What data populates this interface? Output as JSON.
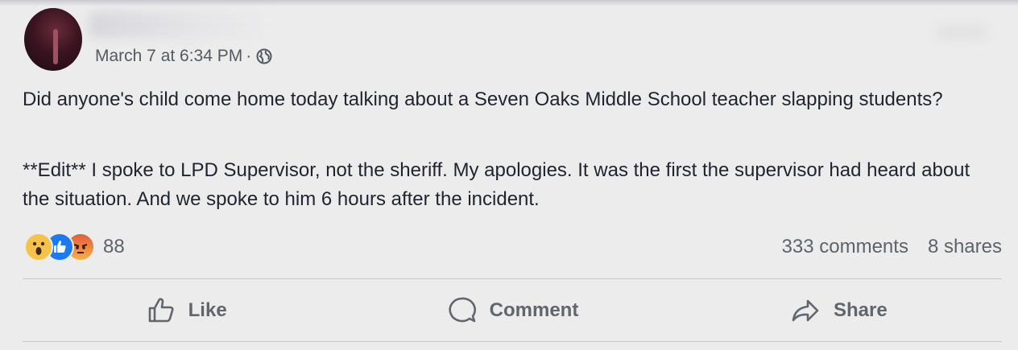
{
  "post": {
    "timestamp": "March 7 at 6:34 PM",
    "separator": "·",
    "privacy_icon": "globe-icon",
    "text_paragraph_1": "Did anyone's child come home today talking about a Seven Oaks Middle School teacher slapping students?",
    "text_paragraph_2": "**Edit** I spoke to LPD Supervisor, not the sheriff. My apologies. It was the first the supervisor had heard about the situation. And we spoke to him 6 hours after the incident."
  },
  "reactions": {
    "icons": [
      "wow-reaction-icon",
      "like-reaction-icon",
      "angry-reaction-icon"
    ],
    "count": "88"
  },
  "stats": {
    "comments": "333 comments",
    "shares": "8 shares"
  },
  "actions": {
    "like_label": "Like",
    "comment_label": "Comment",
    "share_label": "Share"
  }
}
